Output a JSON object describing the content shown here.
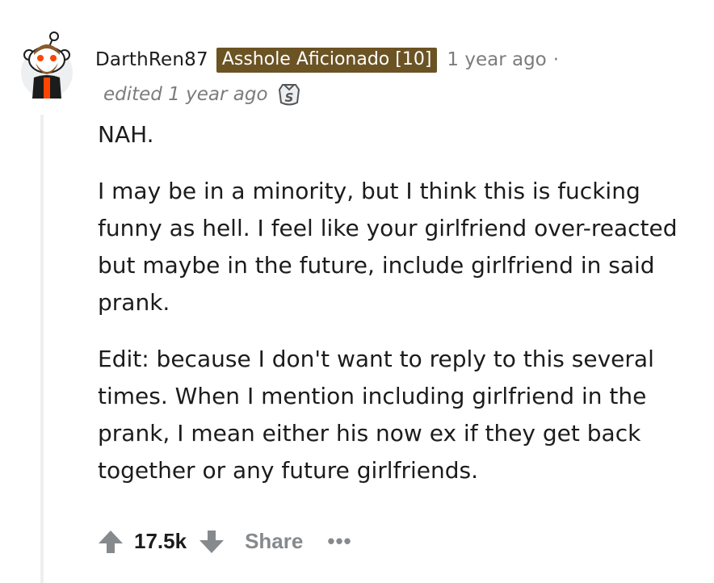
{
  "comment": {
    "author": "DarthRen87",
    "flair": "Asshole Aficionado [10]",
    "timestamp": "1 year ago",
    "separator": "·",
    "edited": "edited 1 year ago",
    "paragraphs": [
      "NAH.",
      "I may be in a minority, but I think this is fucking funny as hell. I feel like your girlfriend over-reacted but maybe in the future, include girlfriend in said prank.",
      "Edit: because I don't want to reply to this several times. When I mention including girlfriend in the prank, I mean either his now ex if they get back together or any future girlfriends."
    ]
  },
  "actions": {
    "upvote_icon": "upvote-arrow-icon",
    "score": "17.5k",
    "downvote_icon": "downvote-arrow-icon",
    "share_label": "Share",
    "more_label": "•••"
  },
  "icons": {
    "avatar": "snoo-avatar-icon",
    "award": "silver-award-icon"
  },
  "colors": {
    "flair_bg": "#6b5324",
    "meta_gray": "#7c7c7c",
    "action_gray": "#878a8c",
    "thread_line": "#edeff1"
  }
}
